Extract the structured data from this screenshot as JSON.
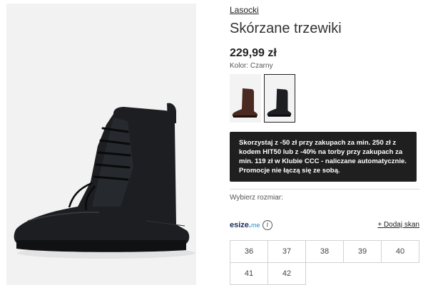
{
  "product": {
    "brand": "Lasocki",
    "title": "Skórzane trzewiki",
    "price": "229,99 zł",
    "color_label": "Kolor: Czarny"
  },
  "color_options": [
    {
      "name": "brown",
      "hex": "#4a2a20",
      "selected": false
    },
    {
      "name": "black",
      "hex": "#1c1e22",
      "selected": true
    }
  ],
  "promo": {
    "lines": [
      "Skorzystaj z -50 zł przy zakupach za min. 250 zł z",
      "kodem HIT50 lub z -40% na torby przy zakupach za",
      "min. 119 zł w Klubie CCC - naliczane automatycznie.",
      "Promocje nie łączą się ze sobą."
    ]
  },
  "size_section": {
    "label": "Wybierz rozmiar:",
    "esize_brand": "esize",
    "esize_tld": "me",
    "info_icon": "i",
    "add_scan": "+ Dodaj skan",
    "sizes": [
      "36",
      "37",
      "38",
      "39",
      "40",
      "41",
      "42"
    ]
  }
}
